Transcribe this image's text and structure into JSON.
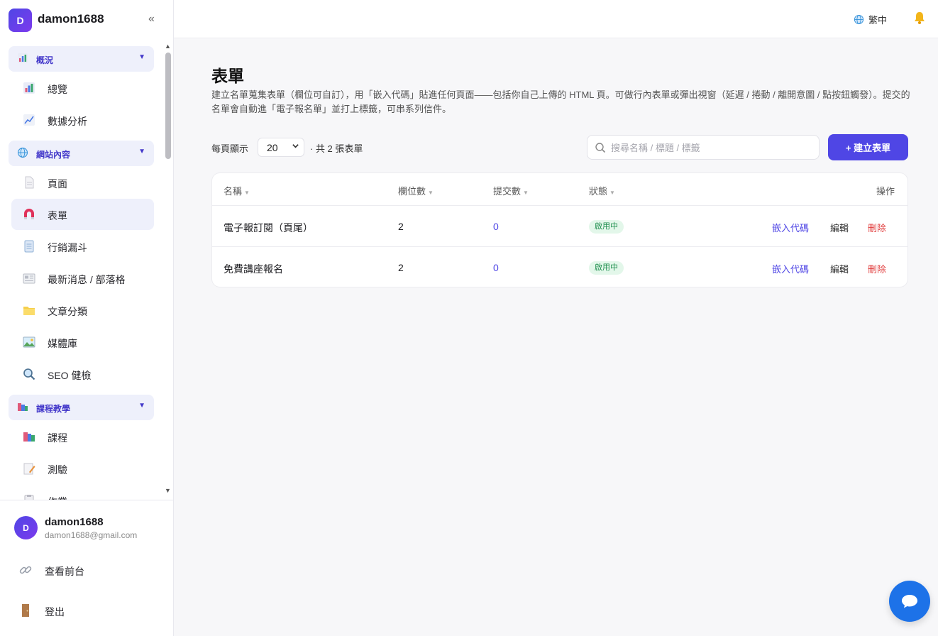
{
  "brand": {
    "initial": "D",
    "name": "damon1688",
    "collapse": "«"
  },
  "nav": {
    "sections": [
      {
        "label": "概況",
        "caret": "▼",
        "icon": "bar-chart-icon"
      },
      {
        "label": "網站內容",
        "caret": "▼",
        "icon": "globe-icon"
      },
      {
        "label": "課程教學",
        "caret": "▼",
        "icon": "books-icon"
      }
    ],
    "items": [
      {
        "label": "總覽",
        "icon": "bar-chart-icon"
      },
      {
        "label": "數據分析",
        "icon": "line-chart-icon"
      },
      {
        "label": "頁面",
        "icon": "page-icon"
      },
      {
        "label": "表單",
        "icon": "magnet-icon"
      },
      {
        "label": "行銷漏斗",
        "icon": "document-icon"
      },
      {
        "label": "最新消息 / 部落格",
        "icon": "newspaper-icon"
      },
      {
        "label": "文章分類",
        "icon": "folder-icon"
      },
      {
        "label": "媒體庫",
        "icon": "image-icon"
      },
      {
        "label": "SEO 健檢",
        "icon": "magnifier-icon"
      },
      {
        "label": "課程",
        "icon": "books-icon"
      },
      {
        "label": "測驗",
        "icon": "memo-icon"
      },
      {
        "label": "作業",
        "icon": "clipboard-icon"
      }
    ]
  },
  "user": {
    "initial": "D",
    "name": "damon1688",
    "email": "damon1688@gmail.com"
  },
  "footer_links": [
    {
      "label": "查看前台",
      "icon": "link-icon"
    },
    {
      "label": "登出",
      "icon": "door-icon"
    }
  ],
  "topbar": {
    "language": "繁中"
  },
  "page": {
    "title": "表單",
    "description": "建立名單蒐集表單（欄位可自訂），用「嵌入代碼」貼進任何頁面——包括你自己上傳的 HTML 頁。可做行內表單或彈出視窗（延遲 / 捲動 / 離開意圖 / 點按鈕觸發）。提交的名單會自動進「電子報名單」並打上標籤，可串系列信件。"
  },
  "toolbar": {
    "per_page_label": "每頁顯示",
    "per_page_value": "20",
    "total": "· 共 2 張表單",
    "search_placeholder": "搜尋名稱 / 標題 / 標籤",
    "create_label": "+ 建立表單"
  },
  "table": {
    "columns": [
      "名稱",
      "欄位數",
      "提交數",
      "狀態",
      "操作"
    ],
    "sort_glyph": "▼",
    "rows": [
      {
        "name": "電子報訂閱（頁尾）",
        "fields": "2",
        "submissions": "0",
        "status": "啟用中",
        "actions": [
          "嵌入代碼",
          "編輯",
          "刪除"
        ]
      },
      {
        "name": "免費講座報名",
        "fields": "2",
        "submissions": "0",
        "status": "啟用中",
        "actions": [
          "嵌入代碼",
          "編輯",
          "刪除"
        ]
      }
    ]
  },
  "colors": {
    "accent": "#4f46e5",
    "danger": "#e03b3b",
    "success_bg": "#e3f7ea",
    "success_text": "#1f8f4e",
    "chat": "#1d72e8"
  }
}
